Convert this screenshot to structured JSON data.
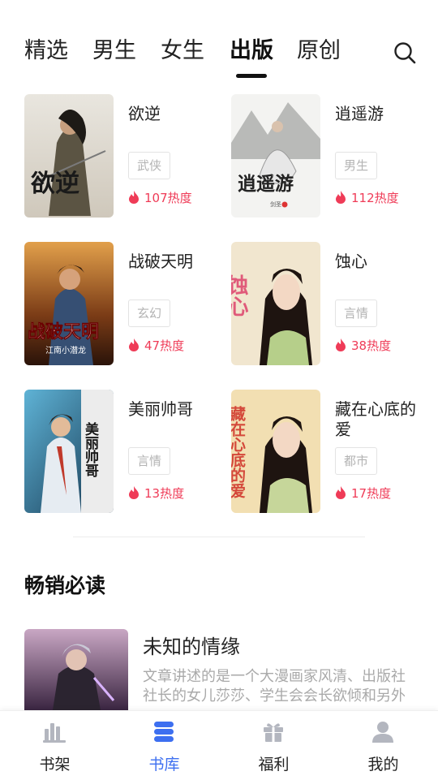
{
  "tabs": [
    {
      "label": "精选",
      "active": false
    },
    {
      "label": "男生",
      "active": false
    },
    {
      "label": "女生",
      "active": false
    },
    {
      "label": "出版",
      "active": true
    },
    {
      "label": "原创",
      "active": false
    }
  ],
  "search": {
    "icon": "search-icon"
  },
  "books": [
    {
      "title": "欲逆",
      "cover_text": "欲逆",
      "tag": "武侠",
      "heat": "107热度"
    },
    {
      "title": "逍遥游",
      "cover_text": "逍遥游",
      "tag": "男生",
      "heat": "112热度"
    },
    {
      "title": "战破天明",
      "cover_text": "战破天明",
      "cover_subtext": "江南小潜龙",
      "tag": "玄幻",
      "heat": "47热度"
    },
    {
      "title": "蚀心",
      "cover_text": "蚀心",
      "tag": "言情",
      "heat": "38热度"
    },
    {
      "title": "美丽帅哥",
      "cover_text": "美丽帅哥",
      "tag": "言情",
      "heat": "13热度"
    },
    {
      "title": "藏在心底的爱",
      "cover_text": "藏在心底的爱",
      "tag": "都市",
      "heat": "17热度"
    }
  ],
  "bestseller": {
    "section_title": "畅销必读",
    "title": "未知的情缘",
    "description": "文章讲述的是一个大漫画家风清、出版社社长的女儿莎莎、学生会会长欲倾和另外"
  },
  "nav": [
    {
      "label": "书架",
      "icon": "bookshelf-icon",
      "active": false
    },
    {
      "label": "书库",
      "icon": "library-icon",
      "active": true
    },
    {
      "label": "福利",
      "icon": "gift-icon",
      "active": false
    },
    {
      "label": "我的",
      "icon": "user-icon",
      "active": false
    }
  ],
  "colors": {
    "accent": "#3d6ff0",
    "heat": "#ef3b57",
    "tag_text": "#b3b3b3"
  }
}
